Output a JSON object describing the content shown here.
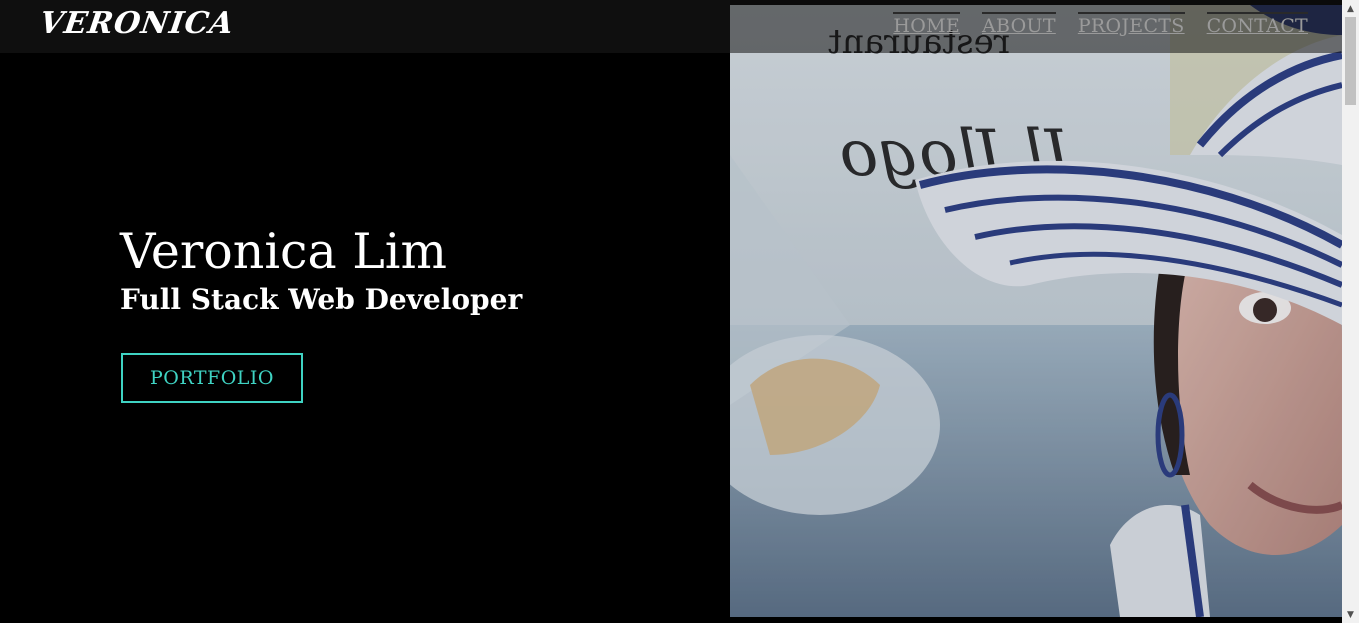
{
  "brand": {
    "logo_text": "VERONICA"
  },
  "nav": {
    "items": [
      {
        "label": "HOME"
      },
      {
        "label": "ABOUT"
      },
      {
        "label": "PROJECTS"
      },
      {
        "label": "CONTACT"
      }
    ]
  },
  "hero": {
    "name": "Veronica Lim",
    "role": "Full Stack Web Developer",
    "cta_label": "PORTFOLIO",
    "photo_sign_text": "restaurant",
    "photo_script_text": "Il Jlogo"
  },
  "colors": {
    "accent": "#3fd3c3",
    "background": "#000000",
    "nav_text": "#9a9a9a",
    "hat_blue": "#2d3f86"
  }
}
